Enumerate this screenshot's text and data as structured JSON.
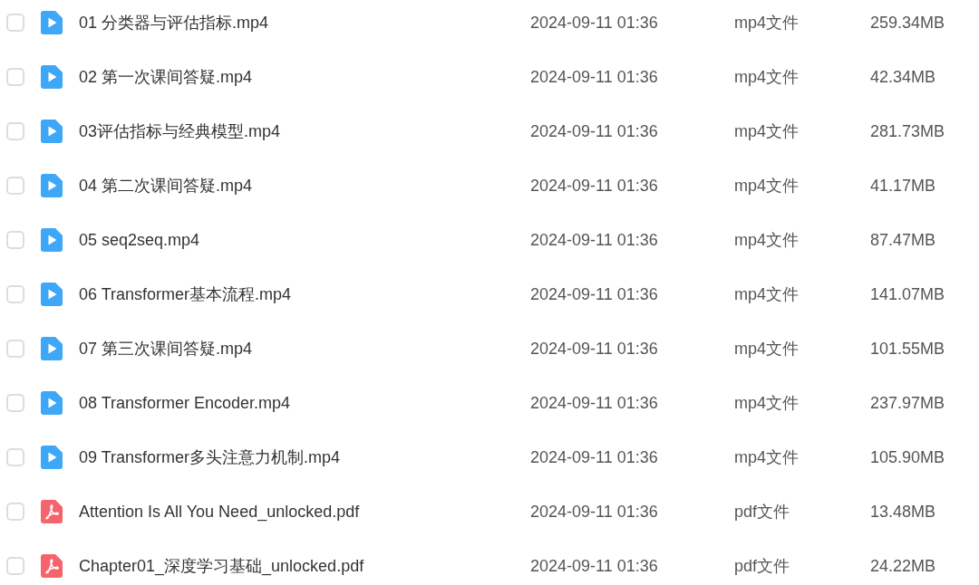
{
  "files": [
    {
      "kind": "video",
      "name": "01 分类器与评估指标.mp4",
      "checked": false,
      "modified": "2024-09-11 01:36",
      "type": "mp4文件",
      "size": "259.34MB"
    },
    {
      "kind": "video",
      "name": "02 第一次课间答疑.mp4",
      "checked": false,
      "modified": "2024-09-11 01:36",
      "type": "mp4文件",
      "size": "42.34MB"
    },
    {
      "kind": "video",
      "name": "03评估指标与经典模型.mp4",
      "checked": false,
      "modified": "2024-09-11 01:36",
      "type": "mp4文件",
      "size": "281.73MB"
    },
    {
      "kind": "video",
      "name": "04 第二次课间答疑.mp4",
      "checked": false,
      "modified": "2024-09-11 01:36",
      "type": "mp4文件",
      "size": "41.17MB"
    },
    {
      "kind": "video",
      "name": "05 seq2seq.mp4",
      "checked": false,
      "modified": "2024-09-11 01:36",
      "type": "mp4文件",
      "size": "87.47MB"
    },
    {
      "kind": "video",
      "name": "06 Transformer基本流程.mp4",
      "checked": false,
      "modified": "2024-09-11 01:36",
      "type": "mp4文件",
      "size": "141.07MB"
    },
    {
      "kind": "video",
      "name": "07 第三次课间答疑.mp4",
      "checked": false,
      "modified": "2024-09-11 01:36",
      "type": "mp4文件",
      "size": "101.55MB"
    },
    {
      "kind": "video",
      "name": "08 Transformer Encoder.mp4",
      "checked": false,
      "modified": "2024-09-11 01:36",
      "type": "mp4文件",
      "size": "237.97MB"
    },
    {
      "kind": "video",
      "name": "09 Transformer多头注意力机制.mp4",
      "checked": false,
      "modified": "2024-09-11 01:36",
      "type": "mp4文件",
      "size": "105.90MB"
    },
    {
      "kind": "pdf",
      "name": "Attention Is All You Need_unlocked.pdf",
      "checked": false,
      "modified": "2024-09-11 01:36",
      "type": "pdf文件",
      "size": "13.48MB"
    },
    {
      "kind": "pdf",
      "name": "Chapter01_深度学习基础_unlocked.pdf",
      "checked": false,
      "modified": "2024-09-11 01:36",
      "type": "pdf文件",
      "size": "24.22MB"
    }
  ]
}
